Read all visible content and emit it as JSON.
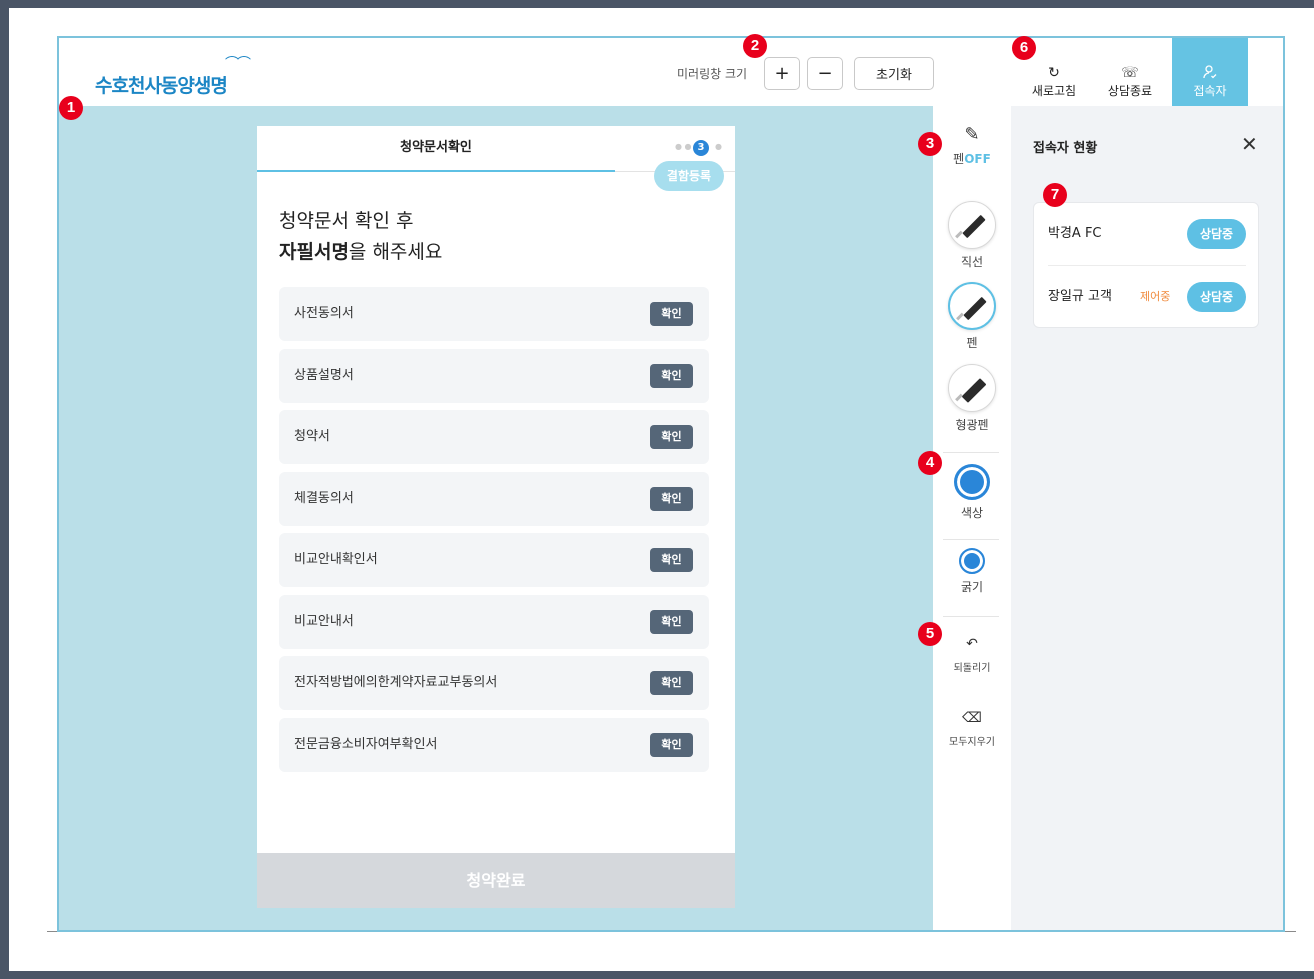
{
  "header": {
    "logo_text": "수호천사동양생명",
    "logo_mark": "⌒⌒",
    "mirror_label": "미러링창 크기",
    "zoom_in_label": "+",
    "zoom_out_label": "−",
    "reset_label": "초기화",
    "refresh_label": "새로고침",
    "end_consult_label": "상담종료",
    "participants_label": "접속자"
  },
  "document_screen": {
    "tab_label": "청약문서확인",
    "step_current": "3",
    "defect_button": "결함등록",
    "heading_line1": "청약문서 확인 후",
    "heading_bold": "자필서명",
    "heading_rest": "을 해주세요",
    "confirm_label": "확인",
    "documents": [
      {
        "name": "사전동의서"
      },
      {
        "name": "상품설명서"
      },
      {
        "name": "청약서"
      },
      {
        "name": "체결동의서"
      },
      {
        "name": "비교안내확인서"
      },
      {
        "name": "비교안내서"
      },
      {
        "name": "전자적방법에의한계약자료교부동의서"
      },
      {
        "name": "전문금융소비자여부확인서"
      }
    ],
    "complete_button": "청약완료"
  },
  "toolbar": {
    "pen_toggle_prefix": "펜",
    "pen_toggle_state": "OFF",
    "line_label": "직선",
    "pen_label": "펜",
    "highlighter_label": "형광펜",
    "color_label": "색상",
    "thickness_label": "굵기",
    "undo_label": "되돌리기",
    "clear_label": "모두지우기",
    "selected_color": "#2a86d8"
  },
  "participants_panel": {
    "title": "접속자 현황",
    "users": [
      {
        "name": "박경A FC",
        "control": "",
        "status": "상담중"
      },
      {
        "name": "장일규 고객",
        "control": "제어중",
        "status": "상담중"
      }
    ]
  },
  "markers": [
    "1",
    "2",
    "3",
    "4",
    "5",
    "6",
    "7"
  ],
  "colors": {
    "accent": "#5ec0e4",
    "brand": "#1c86c5",
    "canvas_bg": "#badfe8",
    "marker": "#e8001c"
  }
}
